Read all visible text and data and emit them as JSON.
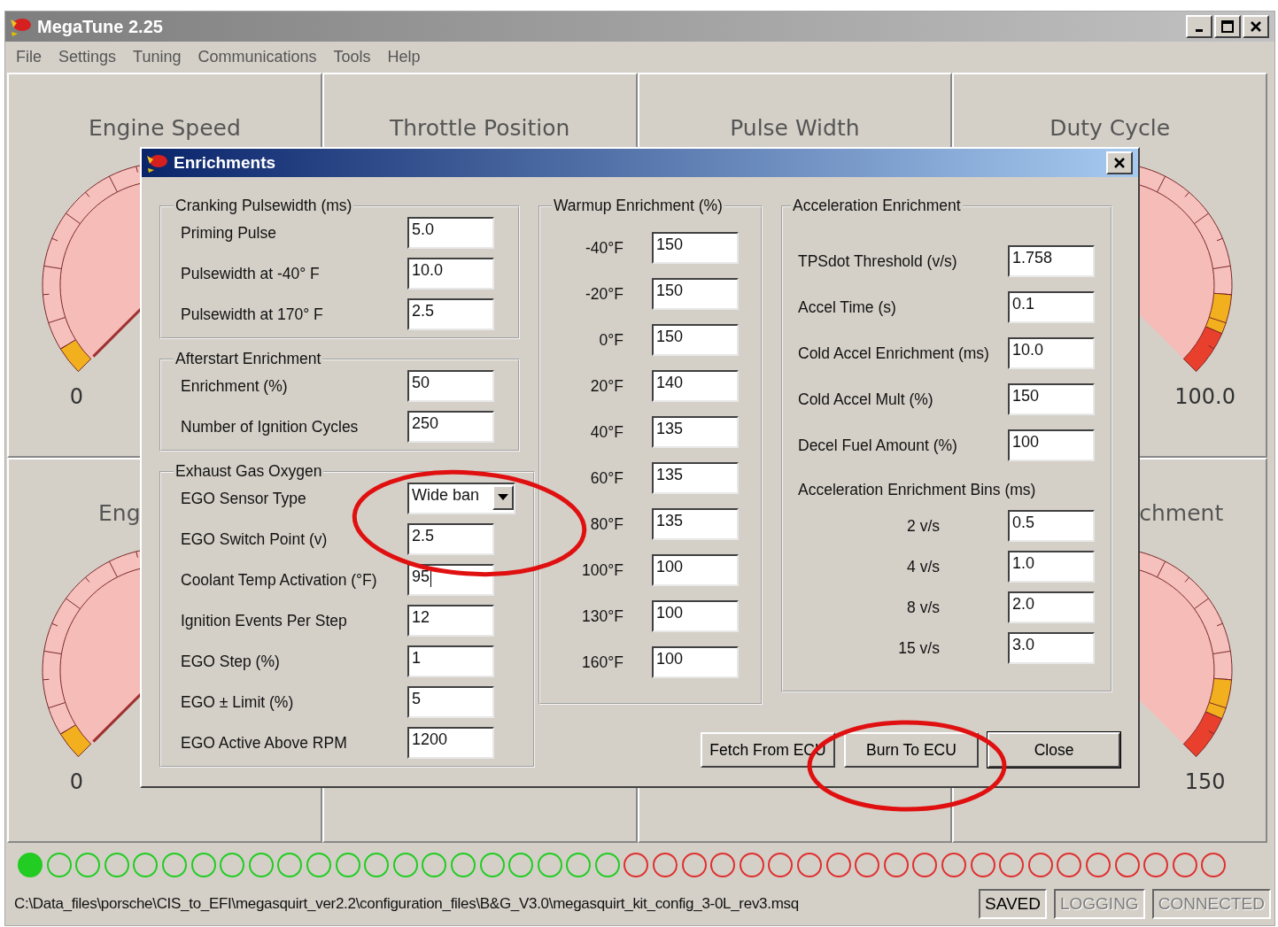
{
  "window": {
    "title": "MegaTune 2.25"
  },
  "menu": [
    "File",
    "Settings",
    "Tuning",
    "Communications",
    "Tools",
    "Help"
  ],
  "gauges": [
    {
      "kind": "gauge",
      "title": "Engine Speed",
      "scale_label": "0"
    },
    {
      "kind": "covered",
      "title": "Throttle Position"
    },
    {
      "kind": "covered",
      "title": "Pulse Width"
    },
    {
      "kind": "gauge",
      "title": "Duty Cycle",
      "scale_label": "100.0"
    },
    {
      "kind": "gauge",
      "title": "Eng",
      "scale_label": "0"
    },
    {
      "kind": "covered"
    },
    {
      "kind": "covered"
    },
    {
      "kind": "gauge",
      "title": "chment",
      "scale_label": "150"
    }
  ],
  "dialog": {
    "title": "Enrichments",
    "columns": [
      [
        {
          "kind": "form",
          "title": "Cranking Pulsewidth (ms)",
          "fields": [
            {
              "kind": "text",
              "label": "Priming Pulse",
              "value": "5.0",
              "focused": false
            },
            {
              "kind": "text",
              "label": "Pulsewidth at -40° F",
              "value": "10.0",
              "focused": false
            },
            {
              "kind": "text",
              "label": "Pulsewidth at  170° F",
              "value": "2.5",
              "focused": false
            }
          ]
        },
        {
          "kind": "form",
          "title": "Afterstart Enrichment",
          "fields": [
            {
              "kind": "text",
              "label": "Enrichment (%)",
              "value": "50",
              "focused": false
            },
            {
              "kind": "text",
              "label": "Number of Ignition Cycles",
              "value": "250",
              "focused": false
            }
          ]
        },
        {
          "kind": "form",
          "title": "Exhaust Gas Oxygen",
          "fields": [
            {
              "kind": "dropdown",
              "label": "EGO Sensor Type",
              "value": "Wide ban",
              "focused": false
            },
            {
              "kind": "text",
              "label": "EGO Switch Point (v)",
              "value": "2.5",
              "focused": false
            },
            {
              "kind": "text",
              "label": "Coolant Temp Activation (°F)",
              "value": "95",
              "focused": true
            },
            {
              "kind": "text",
              "label": "Ignition Events Per Step",
              "value": "12",
              "focused": false
            },
            {
              "kind": "text",
              "label": "EGO Step (%)",
              "value": "1",
              "focused": false
            },
            {
              "kind": "text",
              "label": "EGO ± Limit (%)",
              "value": "5",
              "focused": false
            },
            {
              "kind": "text",
              "label": "EGO Active Above RPM",
              "value": "1200",
              "focused": false
            }
          ]
        }
      ],
      [
        {
          "kind": "table",
          "title": "Warmup Enrichment (%)",
          "fields": [
            {
              "kind": "text",
              "label": "-40°F",
              "value": "150",
              "focused": false
            },
            {
              "kind": "text",
              "label": "-20°F",
              "value": "150",
              "focused": false
            },
            {
              "kind": "text",
              "label": "0°F",
              "value": "150",
              "focused": false
            },
            {
              "kind": "text",
              "label": "20°F",
              "value": "140",
              "focused": false
            },
            {
              "kind": "text",
              "label": "40°F",
              "value": "135",
              "focused": false
            },
            {
              "kind": "text",
              "label": "60°F",
              "value": "135",
              "focused": false
            },
            {
              "kind": "text",
              "label": "80°F",
              "value": "135",
              "focused": false
            },
            {
              "kind": "text",
              "label": "100°F",
              "value": "100",
              "focused": false
            },
            {
              "kind": "text",
              "label": "130°F",
              "value": "100",
              "focused": false
            },
            {
              "kind": "text",
              "label": "160°F",
              "value": "100",
              "focused": false
            }
          ]
        }
      ],
      [
        {
          "kind": "form",
          "title": "Acceleration Enrichment",
          "fields": [
            {
              "kind": "text",
              "label": "TPSdot Threshold (v/s)",
              "value": "1.758",
              "focused": false
            },
            {
              "kind": "text",
              "label": "Accel Time (s)",
              "value": "0.1",
              "focused": false
            },
            {
              "kind": "text",
              "label": "Cold Accel Enrichment (ms)",
              "value": "10.0",
              "focused": false
            },
            {
              "kind": "text",
              "label": "Cold Accel Mult (%)",
              "value": "150",
              "focused": false
            },
            {
              "kind": "text",
              "label": "Decel Fuel Amount (%)",
              "value": "100",
              "focused": false
            }
          ],
          "bins_title": "Acceleration Enrichment Bins (ms)",
          "bins": [
            {
              "kind": "text",
              "label": "2 v/s",
              "value": "0.5",
              "focused": false
            },
            {
              "kind": "text",
              "label": "4 v/s",
              "value": "1.0",
              "focused": false
            },
            {
              "kind": "text",
              "label": "8 v/s",
              "value": "2.0",
              "focused": false
            },
            {
              "kind": "text",
              "label": "15 v/s",
              "value": "3.0",
              "focused": false
            }
          ]
        }
      ]
    ],
    "buttons": [
      {
        "label": "Fetch From ECU",
        "default": false
      },
      {
        "label": "Burn To ECU",
        "default": false
      },
      {
        "label": "Close",
        "default": true
      }
    ]
  },
  "indicators": [
    {
      "color": "#22cc22",
      "lit": true
    },
    {
      "color": "#22cc22",
      "lit": false
    },
    {
      "color": "#22cc22",
      "lit": false
    },
    {
      "color": "#22cc22",
      "lit": false
    },
    {
      "color": "#22cc22",
      "lit": false
    },
    {
      "color": "#22cc22",
      "lit": false
    },
    {
      "color": "#22cc22",
      "lit": false
    },
    {
      "color": "#22cc22",
      "lit": false
    },
    {
      "color": "#22cc22",
      "lit": false
    },
    {
      "color": "#22cc22",
      "lit": false
    },
    {
      "color": "#22cc22",
      "lit": false
    },
    {
      "color": "#22cc22",
      "lit": false
    },
    {
      "color": "#22cc22",
      "lit": false
    },
    {
      "color": "#22cc22",
      "lit": false
    },
    {
      "color": "#22cc22",
      "lit": false
    },
    {
      "color": "#22cc22",
      "lit": false
    },
    {
      "color": "#22cc22",
      "lit": false
    },
    {
      "color": "#22cc22",
      "lit": false
    },
    {
      "color": "#22cc22",
      "lit": false
    },
    {
      "color": "#22cc22",
      "lit": false
    },
    {
      "color": "#22cc22",
      "lit": false
    },
    {
      "color": "#e03030",
      "lit": false
    },
    {
      "color": "#e03030",
      "lit": false
    },
    {
      "color": "#e03030",
      "lit": false
    },
    {
      "color": "#e03030",
      "lit": false
    },
    {
      "color": "#e03030",
      "lit": false
    },
    {
      "color": "#e03030",
      "lit": false
    },
    {
      "color": "#e03030",
      "lit": false
    },
    {
      "color": "#e03030",
      "lit": false
    },
    {
      "color": "#e03030",
      "lit": false
    },
    {
      "color": "#e03030",
      "lit": false
    },
    {
      "color": "#e03030",
      "lit": false
    },
    {
      "color": "#e03030",
      "lit": false
    },
    {
      "color": "#e03030",
      "lit": false
    },
    {
      "color": "#e03030",
      "lit": false
    },
    {
      "color": "#e03030",
      "lit": false
    },
    {
      "color": "#e03030",
      "lit": false
    },
    {
      "color": "#e03030",
      "lit": false
    },
    {
      "color": "#e03030",
      "lit": false
    },
    {
      "color": "#e03030",
      "lit": false
    },
    {
      "color": "#e03030",
      "lit": false
    },
    {
      "color": "#e03030",
      "lit": false
    }
  ],
  "status_bar": {
    "path": "C:\\Data_files\\porsche\\CIS_to_EFI\\megasquirt_ver2.2\\configuration_files\\B&G_V3.0\\megasquirt_kit_config_3-0L_rev3.msq",
    "flags": [
      {
        "label": "SAVED",
        "disabled": false
      },
      {
        "label": "LOGGING",
        "disabled": true
      },
      {
        "label": "CONNECTED",
        "disabled": true
      }
    ]
  }
}
